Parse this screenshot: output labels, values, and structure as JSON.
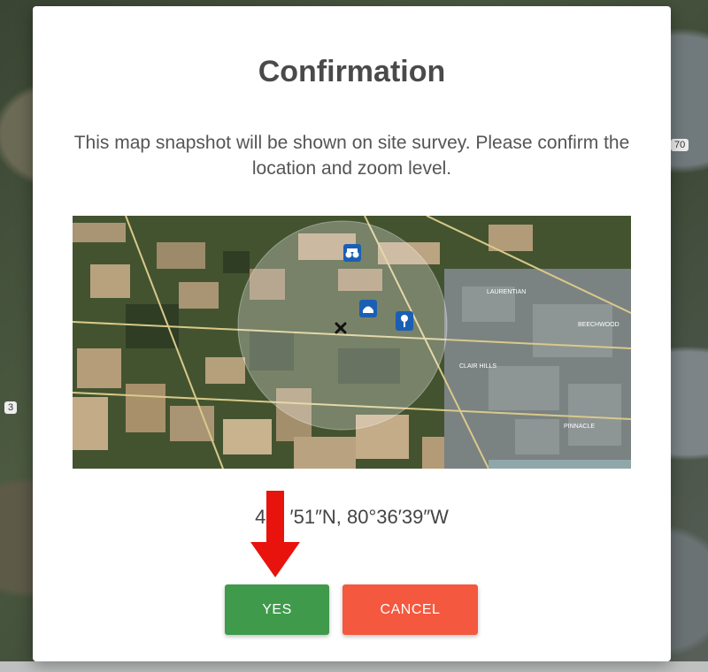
{
  "dialog": {
    "title": "Confirmation",
    "message": "This map snapshot will be shown on site survey. Please confirm the location and zoom level.",
    "coordinates": "43°  ′51″N, 80°36′39″W",
    "yes_label": "YES",
    "cancel_label": "CANCEL"
  },
  "map": {
    "labels": {
      "laurentian": "LAURENTIAN",
      "beechwood": "BEECHWOOD",
      "clair_hills": "CLAIR HILLS",
      "pinnacle": "PINNACLE"
    },
    "markers": [
      "binoculars-icon",
      "police-cap-icon",
      "map-pin-icon",
      "crosshair-icon"
    ]
  },
  "background": {
    "road_labels": [
      "70",
      "3"
    ]
  },
  "colors": {
    "yes": "#3f9a4c",
    "cancel": "#f4583f",
    "arrow": "#e8130c",
    "marker": "#1a5fb4"
  }
}
